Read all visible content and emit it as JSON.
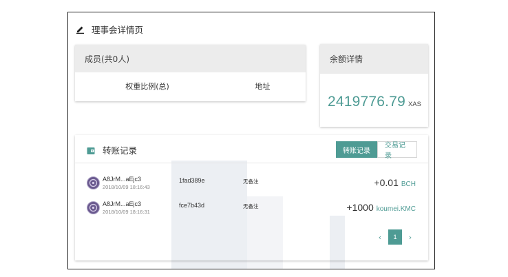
{
  "page": {
    "title": "理事会详情页"
  },
  "members": {
    "header": "成员(共0人)",
    "columns": [
      "权重比例(总)",
      "地址"
    ]
  },
  "balance": {
    "header": "余额详情",
    "amount": "2419776.79",
    "unit": "XAS"
  },
  "transfers": {
    "title": "转账记录",
    "tabs": [
      {
        "label": "转账记录",
        "active": true
      },
      {
        "label": "交易记录",
        "active": false
      }
    ],
    "rows": [
      {
        "address": "A8JrM...aEjc3",
        "time": "2018/10/09 18:16:43",
        "hash": "1fad389e",
        "memo": "无备注",
        "amount": "+0.01",
        "unit": "BCH"
      },
      {
        "address": "A8JrM...aEjc3",
        "time": "2018/10/09 18:16:31",
        "hash": "fce7b43d",
        "memo": "无备注",
        "amount": "+1000",
        "unit": "koumei.KMC"
      }
    ],
    "pagination": {
      "prev": "‹",
      "current": "1",
      "next": "›"
    }
  },
  "colors": {
    "accent": "#4e9b94",
    "header_bg": "#ececec"
  }
}
